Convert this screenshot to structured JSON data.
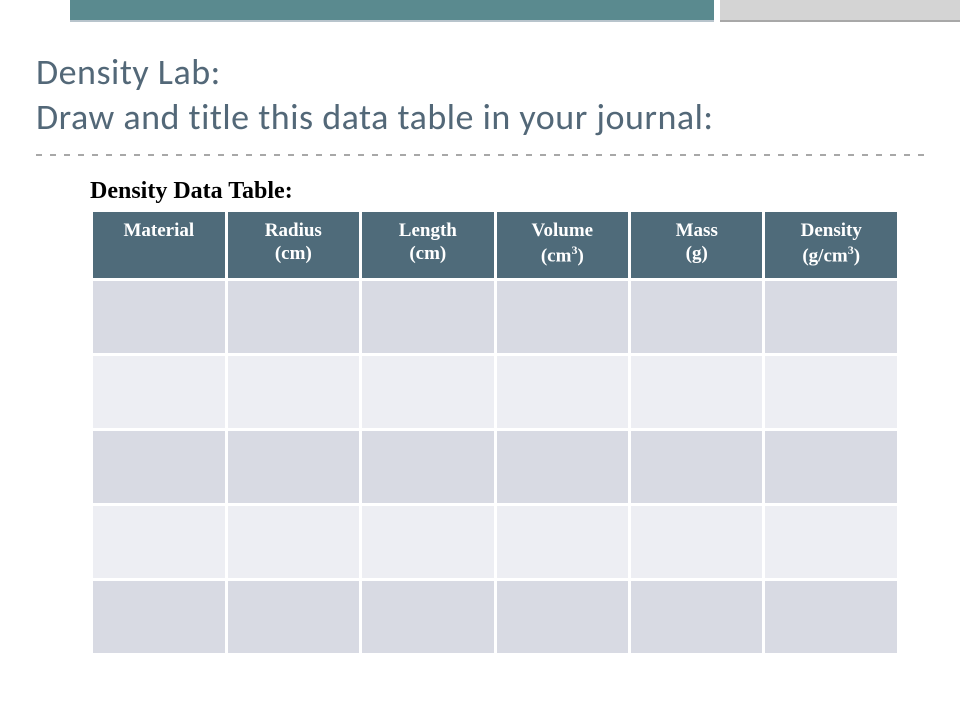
{
  "title_line1": "Density Lab:",
  "title_line2": "Draw and title this data table in your journal:",
  "table_title": "Density Data Table:",
  "headers": [
    {
      "label": "Material",
      "unit": ""
    },
    {
      "label": "Radius",
      "unit": "(cm)"
    },
    {
      "label": "Length",
      "unit": "(cm)"
    },
    {
      "label": "Volume",
      "unit_html": "(cm³)"
    },
    {
      "label": "Mass",
      "unit": "(g)"
    },
    {
      "label": "Density",
      "unit_html": "(g/cm³)"
    }
  ],
  "row_count": 5,
  "col_count": 6,
  "colors": {
    "title_text": "#536878",
    "header_bg": "#4f6b7a",
    "row_odd": "#d8dae3",
    "row_even": "#edeef3",
    "top_teal": "#5a8a8f",
    "top_gray": "#d4d4d4"
  }
}
